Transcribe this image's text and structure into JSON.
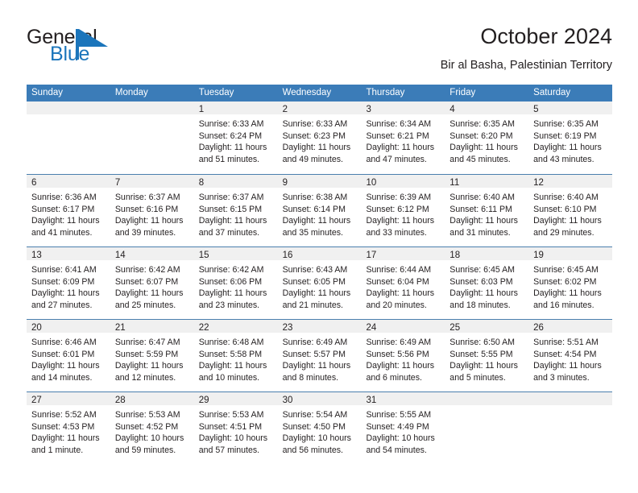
{
  "brand": {
    "name_part1": "General",
    "name_part2": "Blue",
    "flag_icon": "triangle-flag-icon",
    "color_dark": "#231f20",
    "color_blue": "#1b75bb"
  },
  "header": {
    "title": "October 2024",
    "subtitle": "Bir al Basha, Palestinian Territory"
  },
  "theme": {
    "header_row_bg": "#3b7cb8",
    "header_row_text": "#ffffff",
    "day_band_bg": "#f0f0f0",
    "row_separator": "#4a7fae",
    "page_bg": "#ffffff"
  },
  "calendar": {
    "weekdays": [
      "Sunday",
      "Monday",
      "Tuesday",
      "Wednesday",
      "Thursday",
      "Friday",
      "Saturday"
    ],
    "weeks": [
      [
        {
          "day": "",
          "empty": true,
          "sunrise": "",
          "sunset": "",
          "daylight_1": "",
          "daylight_2": ""
        },
        {
          "day": "",
          "empty": true,
          "sunrise": "",
          "sunset": "",
          "daylight_1": "",
          "daylight_2": ""
        },
        {
          "day": "1",
          "empty": false,
          "sunrise": "Sunrise: 6:33 AM",
          "sunset": "Sunset: 6:24 PM",
          "daylight_1": "Daylight: 11 hours",
          "daylight_2": "and 51 minutes."
        },
        {
          "day": "2",
          "empty": false,
          "sunrise": "Sunrise: 6:33 AM",
          "sunset": "Sunset: 6:23 PM",
          "daylight_1": "Daylight: 11 hours",
          "daylight_2": "and 49 minutes."
        },
        {
          "day": "3",
          "empty": false,
          "sunrise": "Sunrise: 6:34 AM",
          "sunset": "Sunset: 6:21 PM",
          "daylight_1": "Daylight: 11 hours",
          "daylight_2": "and 47 minutes."
        },
        {
          "day": "4",
          "empty": false,
          "sunrise": "Sunrise: 6:35 AM",
          "sunset": "Sunset: 6:20 PM",
          "daylight_1": "Daylight: 11 hours",
          "daylight_2": "and 45 minutes."
        },
        {
          "day": "5",
          "empty": false,
          "sunrise": "Sunrise: 6:35 AM",
          "sunset": "Sunset: 6:19 PM",
          "daylight_1": "Daylight: 11 hours",
          "daylight_2": "and 43 minutes."
        }
      ],
      [
        {
          "day": "6",
          "empty": false,
          "sunrise": "Sunrise: 6:36 AM",
          "sunset": "Sunset: 6:17 PM",
          "daylight_1": "Daylight: 11 hours",
          "daylight_2": "and 41 minutes."
        },
        {
          "day": "7",
          "empty": false,
          "sunrise": "Sunrise: 6:37 AM",
          "sunset": "Sunset: 6:16 PM",
          "daylight_1": "Daylight: 11 hours",
          "daylight_2": "and 39 minutes."
        },
        {
          "day": "8",
          "empty": false,
          "sunrise": "Sunrise: 6:37 AM",
          "sunset": "Sunset: 6:15 PM",
          "daylight_1": "Daylight: 11 hours",
          "daylight_2": "and 37 minutes."
        },
        {
          "day": "9",
          "empty": false,
          "sunrise": "Sunrise: 6:38 AM",
          "sunset": "Sunset: 6:14 PM",
          "daylight_1": "Daylight: 11 hours",
          "daylight_2": "and 35 minutes."
        },
        {
          "day": "10",
          "empty": false,
          "sunrise": "Sunrise: 6:39 AM",
          "sunset": "Sunset: 6:12 PM",
          "daylight_1": "Daylight: 11 hours",
          "daylight_2": "and 33 minutes."
        },
        {
          "day": "11",
          "empty": false,
          "sunrise": "Sunrise: 6:40 AM",
          "sunset": "Sunset: 6:11 PM",
          "daylight_1": "Daylight: 11 hours",
          "daylight_2": "and 31 minutes."
        },
        {
          "day": "12",
          "empty": false,
          "sunrise": "Sunrise: 6:40 AM",
          "sunset": "Sunset: 6:10 PM",
          "daylight_1": "Daylight: 11 hours",
          "daylight_2": "and 29 minutes."
        }
      ],
      [
        {
          "day": "13",
          "empty": false,
          "sunrise": "Sunrise: 6:41 AM",
          "sunset": "Sunset: 6:09 PM",
          "daylight_1": "Daylight: 11 hours",
          "daylight_2": "and 27 minutes."
        },
        {
          "day": "14",
          "empty": false,
          "sunrise": "Sunrise: 6:42 AM",
          "sunset": "Sunset: 6:07 PM",
          "daylight_1": "Daylight: 11 hours",
          "daylight_2": "and 25 minutes."
        },
        {
          "day": "15",
          "empty": false,
          "sunrise": "Sunrise: 6:42 AM",
          "sunset": "Sunset: 6:06 PM",
          "daylight_1": "Daylight: 11 hours",
          "daylight_2": "and 23 minutes."
        },
        {
          "day": "16",
          "empty": false,
          "sunrise": "Sunrise: 6:43 AM",
          "sunset": "Sunset: 6:05 PM",
          "daylight_1": "Daylight: 11 hours",
          "daylight_2": "and 21 minutes."
        },
        {
          "day": "17",
          "empty": false,
          "sunrise": "Sunrise: 6:44 AM",
          "sunset": "Sunset: 6:04 PM",
          "daylight_1": "Daylight: 11 hours",
          "daylight_2": "and 20 minutes."
        },
        {
          "day": "18",
          "empty": false,
          "sunrise": "Sunrise: 6:45 AM",
          "sunset": "Sunset: 6:03 PM",
          "daylight_1": "Daylight: 11 hours",
          "daylight_2": "and 18 minutes."
        },
        {
          "day": "19",
          "empty": false,
          "sunrise": "Sunrise: 6:45 AM",
          "sunset": "Sunset: 6:02 PM",
          "daylight_1": "Daylight: 11 hours",
          "daylight_2": "and 16 minutes."
        }
      ],
      [
        {
          "day": "20",
          "empty": false,
          "sunrise": "Sunrise: 6:46 AM",
          "sunset": "Sunset: 6:01 PM",
          "daylight_1": "Daylight: 11 hours",
          "daylight_2": "and 14 minutes."
        },
        {
          "day": "21",
          "empty": false,
          "sunrise": "Sunrise: 6:47 AM",
          "sunset": "Sunset: 5:59 PM",
          "daylight_1": "Daylight: 11 hours",
          "daylight_2": "and 12 minutes."
        },
        {
          "day": "22",
          "empty": false,
          "sunrise": "Sunrise: 6:48 AM",
          "sunset": "Sunset: 5:58 PM",
          "daylight_1": "Daylight: 11 hours",
          "daylight_2": "and 10 minutes."
        },
        {
          "day": "23",
          "empty": false,
          "sunrise": "Sunrise: 6:49 AM",
          "sunset": "Sunset: 5:57 PM",
          "daylight_1": "Daylight: 11 hours",
          "daylight_2": "and 8 minutes."
        },
        {
          "day": "24",
          "empty": false,
          "sunrise": "Sunrise: 6:49 AM",
          "sunset": "Sunset: 5:56 PM",
          "daylight_1": "Daylight: 11 hours",
          "daylight_2": "and 6 minutes."
        },
        {
          "day": "25",
          "empty": false,
          "sunrise": "Sunrise: 6:50 AM",
          "sunset": "Sunset: 5:55 PM",
          "daylight_1": "Daylight: 11 hours",
          "daylight_2": "and 5 minutes."
        },
        {
          "day": "26",
          "empty": false,
          "sunrise": "Sunrise: 5:51 AM",
          "sunset": "Sunset: 4:54 PM",
          "daylight_1": "Daylight: 11 hours",
          "daylight_2": "and 3 minutes."
        }
      ],
      [
        {
          "day": "27",
          "empty": false,
          "sunrise": "Sunrise: 5:52 AM",
          "sunset": "Sunset: 4:53 PM",
          "daylight_1": "Daylight: 11 hours",
          "daylight_2": "and 1 minute."
        },
        {
          "day": "28",
          "empty": false,
          "sunrise": "Sunrise: 5:53 AM",
          "sunset": "Sunset: 4:52 PM",
          "daylight_1": "Daylight: 10 hours",
          "daylight_2": "and 59 minutes."
        },
        {
          "day": "29",
          "empty": false,
          "sunrise": "Sunrise: 5:53 AM",
          "sunset": "Sunset: 4:51 PM",
          "daylight_1": "Daylight: 10 hours",
          "daylight_2": "and 57 minutes."
        },
        {
          "day": "30",
          "empty": false,
          "sunrise": "Sunrise: 5:54 AM",
          "sunset": "Sunset: 4:50 PM",
          "daylight_1": "Daylight: 10 hours",
          "daylight_2": "and 56 minutes."
        },
        {
          "day": "31",
          "empty": false,
          "sunrise": "Sunrise: 5:55 AM",
          "sunset": "Sunset: 4:49 PM",
          "daylight_1": "Daylight: 10 hours",
          "daylight_2": "and 54 minutes."
        },
        {
          "day": "",
          "empty": true,
          "sunrise": "",
          "sunset": "",
          "daylight_1": "",
          "daylight_2": ""
        },
        {
          "day": "",
          "empty": true,
          "sunrise": "",
          "sunset": "",
          "daylight_1": "",
          "daylight_2": ""
        }
      ]
    ]
  }
}
